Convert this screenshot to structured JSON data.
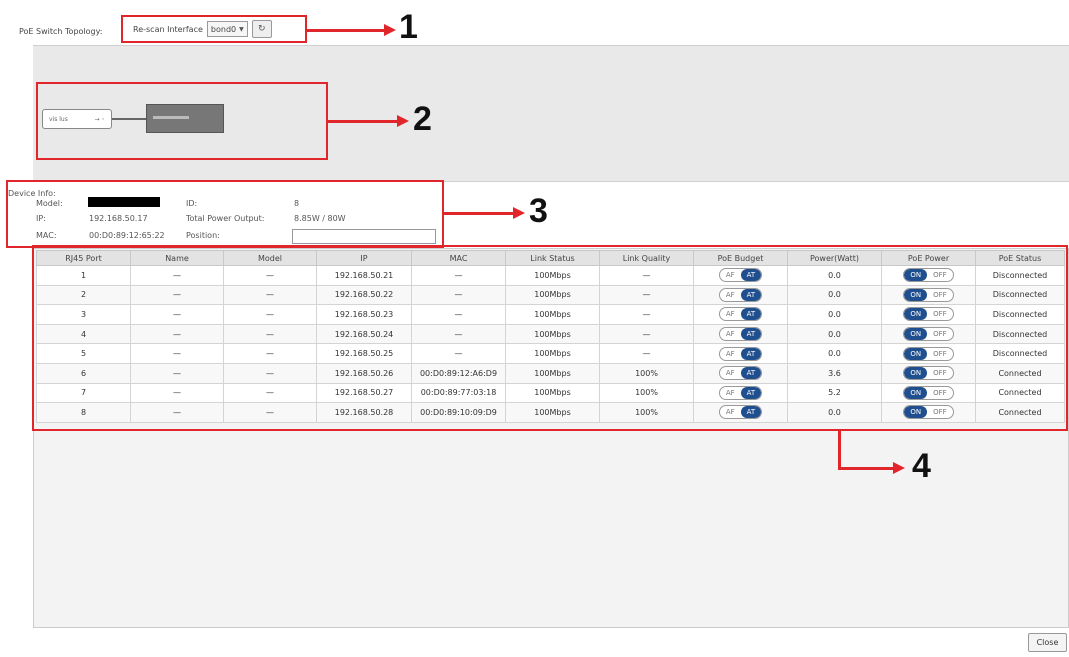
{
  "header": {
    "topology_label": "PoE Switch Topology:",
    "rescan_label": "Re-scan Interface",
    "interface_value": "bond0",
    "refresh_icon": "refresh-icon"
  },
  "topology": {
    "node_label_left": "vis lus",
    "node_label_right": "→ ◦"
  },
  "device_info": {
    "title": "Device Info:",
    "model_label": "Model:",
    "ip_label": "IP:",
    "ip_value": "192.168.50.17",
    "mac_label": "MAC:",
    "mac_value": "00:D0:89:12:65:22",
    "id_label": "ID:",
    "id_value": "8",
    "power_label": "Total Power Output:",
    "power_value": "8.85W / 80W",
    "position_label": "Position:"
  },
  "table": {
    "columns": [
      "RJ45 Port",
      "Name",
      "Model",
      "IP",
      "MAC",
      "Link Status",
      "Link Quality",
      "PoE Budget",
      "Power(Watt)",
      "PoE Power",
      "PoE Status"
    ],
    "budget_labels": {
      "af": "AF",
      "at": "AT"
    },
    "power_labels": {
      "on": "ON",
      "off": "OFF"
    },
    "rows": [
      {
        "port": "1",
        "name": "—",
        "model": "—",
        "ip": "192.168.50.21",
        "mac": "—",
        "link_status": "100Mbps",
        "link_quality": "—",
        "power_watt": "0.0",
        "poe_status": "Disconnected"
      },
      {
        "port": "2",
        "name": "—",
        "model": "—",
        "ip": "192.168.50.22",
        "mac": "—",
        "link_status": "100Mbps",
        "link_quality": "—",
        "power_watt": "0.0",
        "poe_status": "Disconnected"
      },
      {
        "port": "3",
        "name": "—",
        "model": "—",
        "ip": "192.168.50.23",
        "mac": "—",
        "link_status": "100Mbps",
        "link_quality": "—",
        "power_watt": "0.0",
        "poe_status": "Disconnected"
      },
      {
        "port": "4",
        "name": "—",
        "model": "—",
        "ip": "192.168.50.24",
        "mac": "—",
        "link_status": "100Mbps",
        "link_quality": "—",
        "power_watt": "0.0",
        "poe_status": "Disconnected"
      },
      {
        "port": "5",
        "name": "—",
        "model": "—",
        "ip": "192.168.50.25",
        "mac": "—",
        "link_status": "100Mbps",
        "link_quality": "—",
        "power_watt": "0.0",
        "poe_status": "Disconnected"
      },
      {
        "port": "6",
        "name": "—",
        "model": "—",
        "ip": "192.168.50.26",
        "mac": "00:D0:89:12:A6:D9",
        "link_status": "100Mbps",
        "link_quality": "100%",
        "power_watt": "3.6",
        "poe_status": "Connected"
      },
      {
        "port": "7",
        "name": "—",
        "model": "—",
        "ip": "192.168.50.27",
        "mac": "00:D0:89:77:03:18",
        "link_status": "100Mbps",
        "link_quality": "100%",
        "power_watt": "5.2",
        "poe_status": "Connected"
      },
      {
        "port": "8",
        "name": "—",
        "model": "—",
        "ip": "192.168.50.28",
        "mac": "00:D0:89:10:09:D9",
        "link_status": "100Mbps",
        "link_quality": "100%",
        "power_watt": "0.0",
        "poe_status": "Connected"
      }
    ]
  },
  "annotations": [
    "1",
    "2",
    "3",
    "4"
  ],
  "footer": {
    "close_label": "Close"
  },
  "colors": {
    "annotation": "#e0262b",
    "toggle_selected": "#1f4f8f"
  }
}
